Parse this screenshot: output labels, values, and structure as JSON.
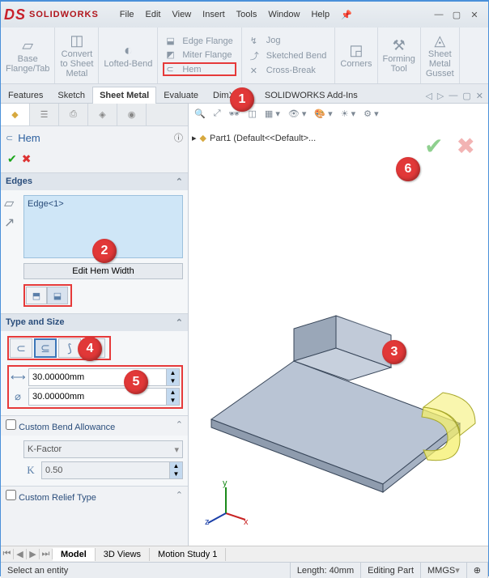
{
  "app": {
    "name": "SOLIDWORKS"
  },
  "menu": {
    "file": "File",
    "edit": "Edit",
    "view": "View",
    "insert": "Insert",
    "tools": "Tools",
    "window": "Window",
    "help": "Help"
  },
  "ribbon": {
    "big": [
      {
        "label": "Base\nFlange/Tab"
      },
      {
        "label": "Convert\nto Sheet\nMetal"
      },
      {
        "label": "Lofted-Bend"
      }
    ],
    "col1": {
      "a": "Edge Flange",
      "b": "Miter Flange",
      "c": "Hem"
    },
    "col2": {
      "a": "Jog",
      "b": "Sketched Bend",
      "c": "Cross-Break"
    },
    "corners": "Corners",
    "forming": "Forming\nTool",
    "gusset": "Sheet\nMetal\nGusset"
  },
  "cmdtabs": {
    "features": "Features",
    "sketch": "Sketch",
    "sheetmetal": "Sheet Metal",
    "evaluate": "Evaluate",
    "dimxpert": "DimXpert",
    "addins": "SOLIDWORKS Add-Ins"
  },
  "panel": {
    "title": "Hem",
    "edges_hd": "Edges",
    "edge_item": "Edge<1>",
    "edit_hem": "Edit Hem Width",
    "type_hd": "Type and Size",
    "val1": "30.00000mm",
    "val2": "30.00000mm",
    "cba_hd": "Custom Bend Allowance",
    "cba_sel": "K-Factor",
    "cba_val": "0.50",
    "crt_hd": "Custom Relief Type"
  },
  "tree": {
    "root": "Part1  (Default<<Default>..."
  },
  "btabs": {
    "model": "Model",
    "views": "3D Views",
    "motion": "Motion Study 1"
  },
  "status": {
    "prompt": "Select an entity",
    "length": "Length: 40mm",
    "mode": "Editing Part",
    "units": "MMGS"
  },
  "callouts": {
    "c1": "1",
    "c2": "2",
    "c3": "3",
    "c4": "4",
    "c5": "5",
    "c6": "6"
  }
}
